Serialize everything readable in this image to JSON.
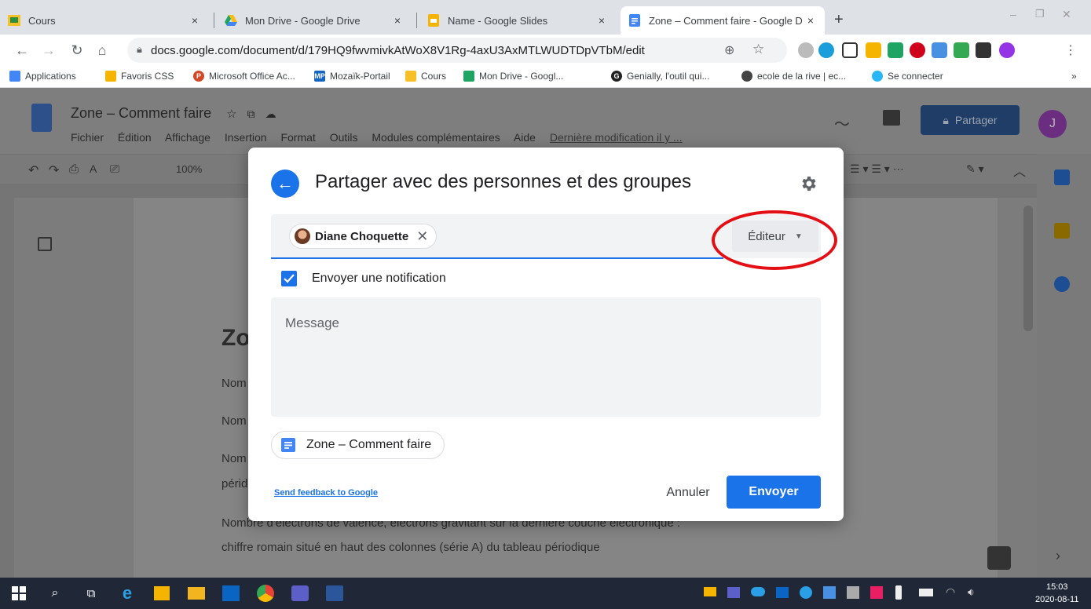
{
  "tabs": [
    {
      "title": "Cours",
      "close": "×"
    },
    {
      "title": "Mon Drive - Google Drive",
      "close": "×"
    },
    {
      "title": "Name - Google Slides",
      "close": "×"
    },
    {
      "title": "Zone – Comment faire - Google D",
      "close": "×"
    }
  ],
  "new_tab": "+",
  "window_controls": {
    "minimize": "–",
    "maximize": "❐",
    "close": "✕"
  },
  "url": "docs.google.com/document/d/179HQ9fwvmivkAtWoX8V1Rg-4axU3AxMTLWUDTDpVTbM/edit",
  "bookmarks": [
    "Applications",
    "Favoris CSS",
    "Microsoft Office Ac...",
    "Mozaïk-Portail",
    "Cours",
    "Mon Drive - Googl...",
    "Genially, l'outil qui...",
    "ecole de la rive | ec...",
    "Se connecter"
  ],
  "bookmarks_more": "»",
  "doc": {
    "title": "Zone – Comment faire",
    "menu": [
      "Fichier",
      "Édition",
      "Affichage",
      "Insertion",
      "Format",
      "Outils",
      "Modules complémentaires",
      "Aide"
    ],
    "last_modified": "Dernière modification il y ...",
    "share_label": "Partager",
    "avatar_letter": "J",
    "zoom": "100%",
    "heading_partial": "Zo",
    "lines_partial": [
      "Nom",
      "Nom",
      "Nom",
      "périd"
    ],
    "line_full_1": "Nombre d'électrons de valence, électrons gravitant sur la dernière couche électronique :",
    "line_full_2": "chiffre romain situé en haut des colonnes (série A) du tableau périodique"
  },
  "dialog": {
    "title": "Partager avec des personnes et des groupes",
    "recipient": "Diane Choquette",
    "role": "Éditeur",
    "notify_label": "Envoyer une notification",
    "message_placeholder": "Message",
    "file_name": "Zone – Comment faire",
    "feedback_link": "Send feedback to Google",
    "cancel": "Annuler",
    "send": "Envoyer"
  },
  "taskbar": {
    "time": "15:03",
    "date": "2020-08-11"
  },
  "colors": {
    "accent": "#1a73e8",
    "highlight_circle": "#e30f14"
  }
}
